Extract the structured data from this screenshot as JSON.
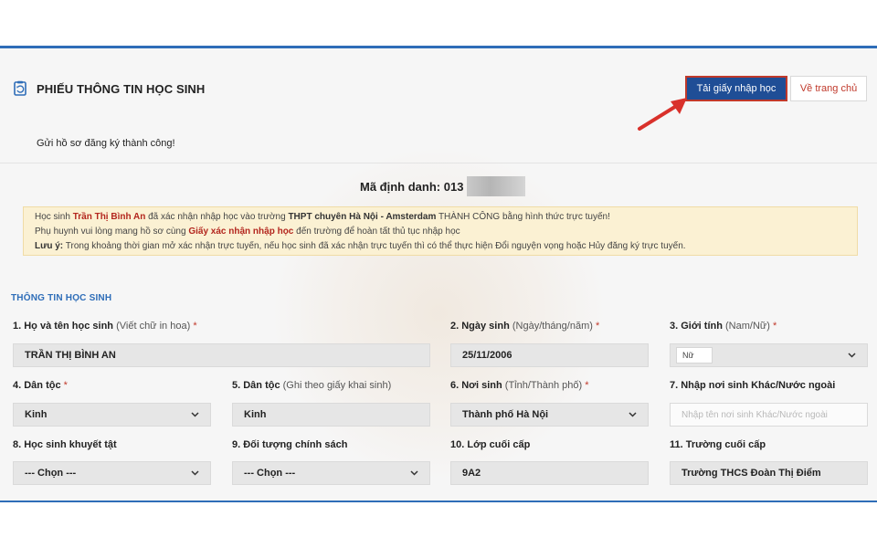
{
  "header": {
    "title": "PHIẾU THÔNG TIN HỌC SINH",
    "icon": "form-refresh-icon"
  },
  "actions": {
    "download": "Tải giấy nhập học",
    "home": "Về trang chủ"
  },
  "colors": {
    "accent": "#2e6db8",
    "primary_button": "#1f4e96",
    "highlight_border": "#c0392b",
    "notice_bg": "#fbf1d3"
  },
  "success_message": "Gửi hồ sơ đăng ký thành công!",
  "identifier": {
    "label": "Mã định danh:",
    "value": "013"
  },
  "notice": {
    "line1_a": "Học sinh",
    "line1_name": "Trần Thị Bình An",
    "line1_b": "đã xác nhận nhập học vào trường",
    "line1_school": "THPT chuyên Hà Nội - Amsterdam",
    "line1_c": "THÀNH CÔNG bằng hình thức trực tuyến!",
    "line2_a": "Phụ huynh vui lòng mang hồ sơ cùng",
    "line2_doc": "Giấy xác nhận nhập học",
    "line2_b": "đến trường để hoàn tất thủ tục nhập học",
    "line3_label": "Lưu ý:",
    "line3_text": "Trong khoảng thời gian mở xác nhận trực tuyến, nếu học sinh đã xác nhận trực tuyến thì có thể thực hiện Đổi nguyện vọng hoặc Hủy đăng ký trực tuyến."
  },
  "section_title": "THÔNG TIN HỌC SINH",
  "fields": {
    "f1": {
      "label": "1. Họ và tên học sinh",
      "hint": "(Viết chữ in hoa)",
      "req": "*",
      "value": "TRẦN THỊ BÌNH AN"
    },
    "f2": {
      "label": "2. Ngày sinh",
      "hint": "(Ngày/tháng/năm)",
      "req": "*",
      "value": "25/11/2006"
    },
    "f3": {
      "label": "3. Giới tính",
      "hint": "(Nam/Nữ)",
      "req": "*",
      "value": "Nữ"
    },
    "f4": {
      "label": "4. Dân tộc",
      "req": "*",
      "value": "Kinh"
    },
    "f5": {
      "label": "5. Dân tộc",
      "hint": "(Ghi theo giấy khai sinh)",
      "value": "Kinh"
    },
    "f6": {
      "label": "6. Nơi sinh",
      "hint": "(Tỉnh/Thành phố)",
      "req": "*",
      "value": "Thành phố Hà Nội"
    },
    "f7": {
      "label": "7. Nhập nơi sinh Khác/Nước ngoài",
      "placeholder": "Nhập tên nơi sinh Khác/Nước ngoài"
    },
    "f8": {
      "label": "8. Học sinh khuyết tật",
      "value": "--- Chọn ---"
    },
    "f9": {
      "label": "9. Đối tượng chính sách",
      "value": "--- Chọn ---"
    },
    "f10": {
      "label": "10. Lớp cuối cấp",
      "value": "9A2"
    },
    "f11": {
      "label": "11. Trường cuối cấp",
      "value": "Trường THCS Đoàn Thị Điểm"
    }
  }
}
